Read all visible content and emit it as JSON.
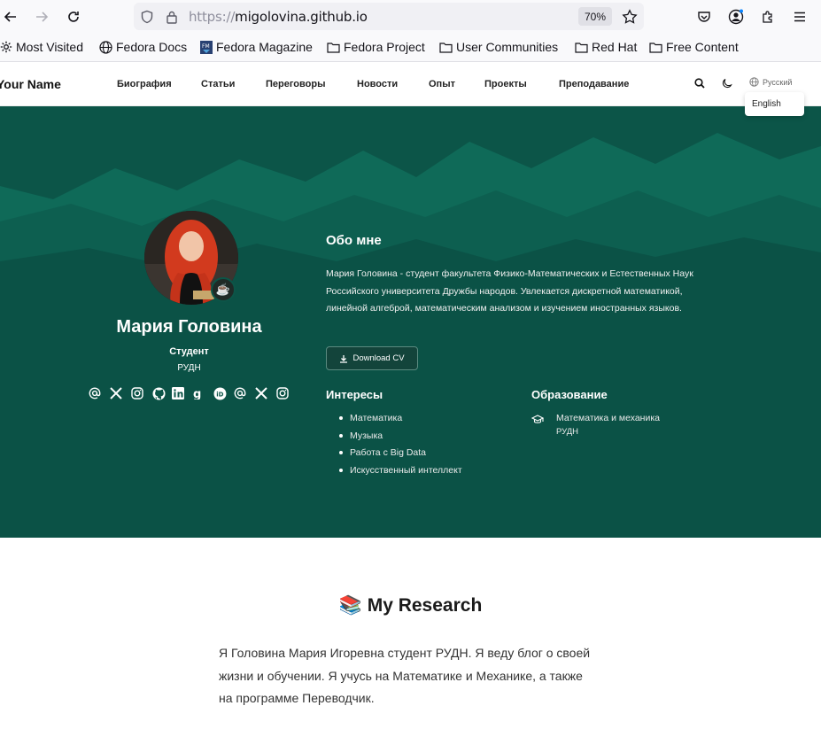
{
  "browser": {
    "url_protocol": "https://",
    "url_host": "migolovina.github.io",
    "zoom": "70%",
    "bookmarks": [
      {
        "label": "Most Visited",
        "icon": "gear-icon"
      },
      {
        "label": "Fedora Docs",
        "icon": "globe-icon"
      },
      {
        "label": "Fedora Magazine",
        "icon": "fedora-magazine-icon"
      },
      {
        "label": "Fedora Project",
        "icon": "folder-icon"
      },
      {
        "label": "User Communities",
        "icon": "folder-icon"
      },
      {
        "label": "Red Hat",
        "icon": "folder-icon"
      },
      {
        "label": "Free Content",
        "icon": "folder-icon"
      }
    ]
  },
  "site": {
    "brand": "Your Name",
    "menu": [
      "Биография",
      "Статьи",
      "Переговоры",
      "Новости",
      "Опыт",
      "Проекты",
      "Преподавание"
    ],
    "language_current": "Русский",
    "language_option": "English"
  },
  "profile": {
    "name": "Мария Головина",
    "role": "Студент",
    "organization": "РУДН",
    "badge_icon": "coffee-icon",
    "social_icons": [
      "at-icon",
      "x-icon",
      "instagram-icon",
      "github-icon",
      "linkedin-icon",
      "google-scholar-icon",
      "orcid-icon",
      "at-icon",
      "x-icon",
      "instagram-icon"
    ]
  },
  "about": {
    "title": "Обо мне",
    "text": "Мария Головина - студент факультета Физико-Математических и Естественных Наук Российского университета Дружбы народов. Увлекается дискретной математикой, линейной алгеброй, математическим анализом и изучением иностранных языков.",
    "cv_button": "Download CV"
  },
  "interests": {
    "title": "Интересы",
    "items": [
      "Математика",
      "Музыка",
      "Работа с Big Data",
      "Искусственный интеллект"
    ]
  },
  "education": {
    "title": "Образование",
    "course": "Математика и механика",
    "institution": "РУДН"
  },
  "research": {
    "title": "📚 My Research",
    "text": "Я Головина Мария Игоревна студент РУДН. Я веду блог о своей жизни и обучении. Я учусь на Математике и Механике, а также на программе Переводчик."
  },
  "colors": {
    "hero_bg": "#0c5548",
    "hero_peaks": "#0f6a58"
  }
}
